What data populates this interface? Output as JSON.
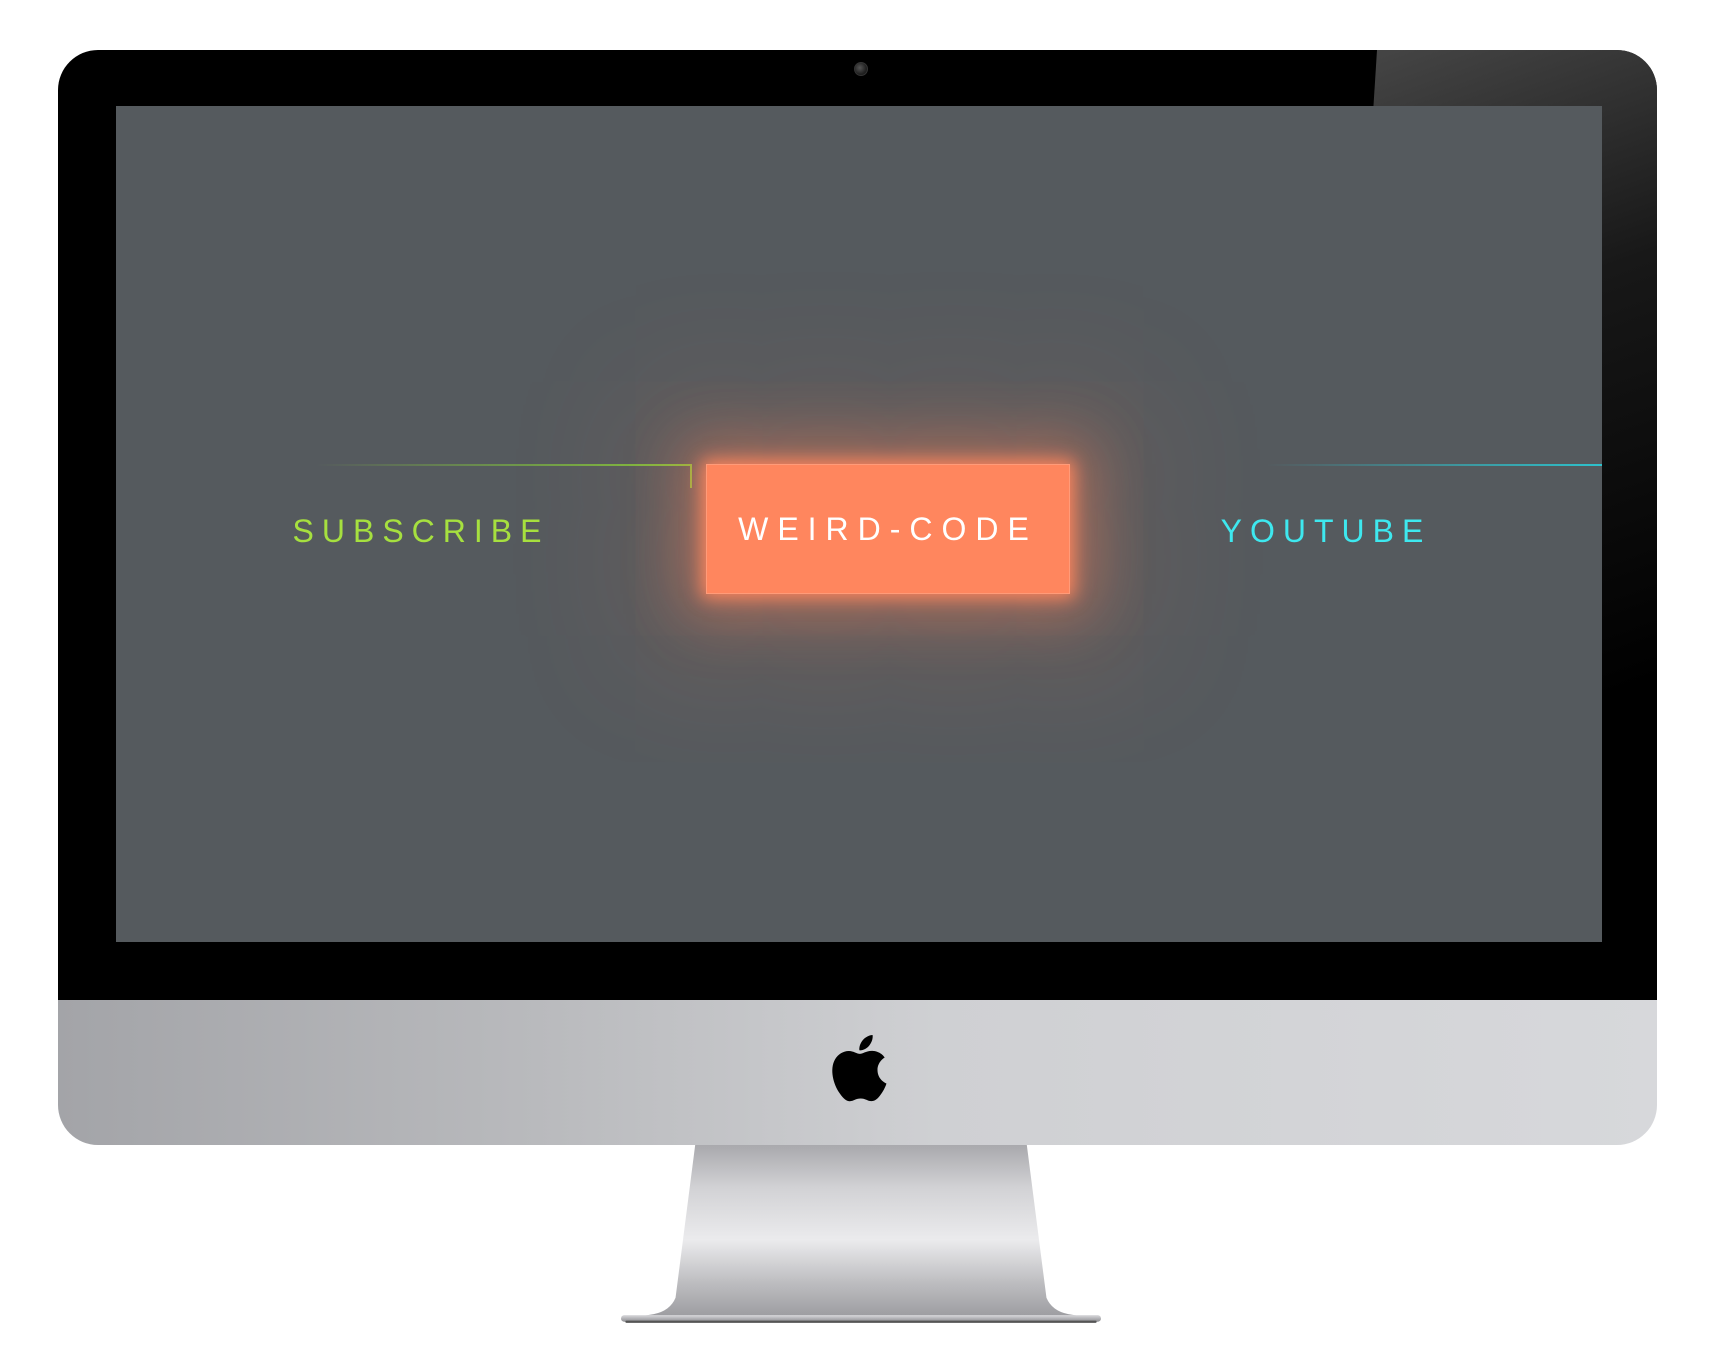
{
  "screen": {
    "background": "#555a5e",
    "links": [
      {
        "label": "SUBSCRIBE",
        "color": "#a6e03f"
      },
      {
        "label": "WEIRD-CODE",
        "color": "#ffffff",
        "fill": "#ff865e"
      },
      {
        "label": "YOUTUBE",
        "color": "#3ee8ef"
      }
    ]
  },
  "hardware": {
    "logo": "apple-icon",
    "camera": "camera-icon"
  }
}
